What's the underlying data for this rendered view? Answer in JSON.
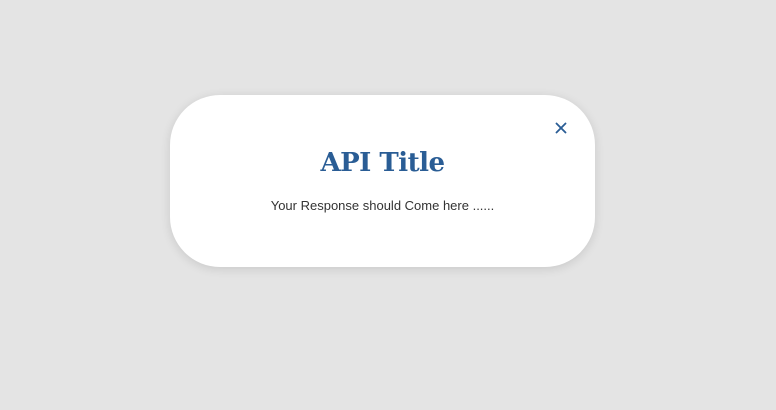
{
  "modal": {
    "title": "API Title",
    "body": "Your Response should Come here ......",
    "close_icon": "close-icon"
  },
  "colors": {
    "background": "#e4e4e4",
    "modal": "#ffffff",
    "accent": "#2a5d95",
    "text": "#333333"
  }
}
